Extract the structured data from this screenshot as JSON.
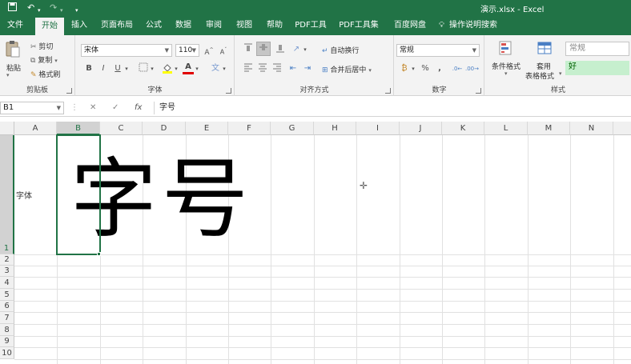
{
  "titlebar": {
    "save_icon": "save-icon",
    "undo_icon": "undo-icon",
    "redo_icon": "redo-icon",
    "customize_icon": "customize-quick-access-icon",
    "title": "演示.xlsx  -  Excel"
  },
  "tabs": [
    {
      "label": "文件"
    },
    {
      "label": "开始"
    },
    {
      "label": "插入"
    },
    {
      "label": "页面布局"
    },
    {
      "label": "公式"
    },
    {
      "label": "数据"
    },
    {
      "label": "审阅"
    },
    {
      "label": "视图"
    },
    {
      "label": "帮助"
    },
    {
      "label": "PDF工具"
    },
    {
      "label": "PDF工具集"
    },
    {
      "label": "百度网盘"
    }
  ],
  "tell_me": "操作说明搜索",
  "ribbon": {
    "clipboard": {
      "paste": "粘贴",
      "cut": "剪切",
      "copy": "复制",
      "format_painter": "格式刷",
      "label": "剪贴板"
    },
    "font": {
      "font_name": "宋体",
      "font_size": "110",
      "bold": "B",
      "italic": "I",
      "underline": "U",
      "grow": "A",
      "shrink": "A",
      "font_color_letter": "A",
      "label": "字体"
    },
    "alignment": {
      "wrap_text": "自动换行",
      "merge_center": "合并后居中",
      "label": "对齐方式"
    },
    "number": {
      "format": "常规",
      "percent": "%",
      "comma": ",",
      "label": "数字"
    },
    "styles": {
      "conditional": "条件格式",
      "table_line1": "套用",
      "table_line2": "表格格式",
      "normal": "常规",
      "good": "好",
      "label": "样式"
    }
  },
  "formula_bar": {
    "name_box": "B1",
    "cancel": "✕",
    "enter": "✓",
    "fx": "fx",
    "content": "字号"
  },
  "sheet": {
    "columns": [
      "A",
      "B",
      "C",
      "D",
      "E",
      "F",
      "G",
      "H",
      "I",
      "J",
      "K",
      "L",
      "M",
      "N"
    ],
    "rows": [
      "1",
      "2",
      "3",
      "4",
      "5",
      "6",
      "7",
      "8",
      "9",
      "10"
    ],
    "a1": "字体",
    "b1": "字号"
  },
  "colors": {
    "accent": "#217346",
    "good_fill": "#c6efce",
    "good_text": "#006100"
  }
}
